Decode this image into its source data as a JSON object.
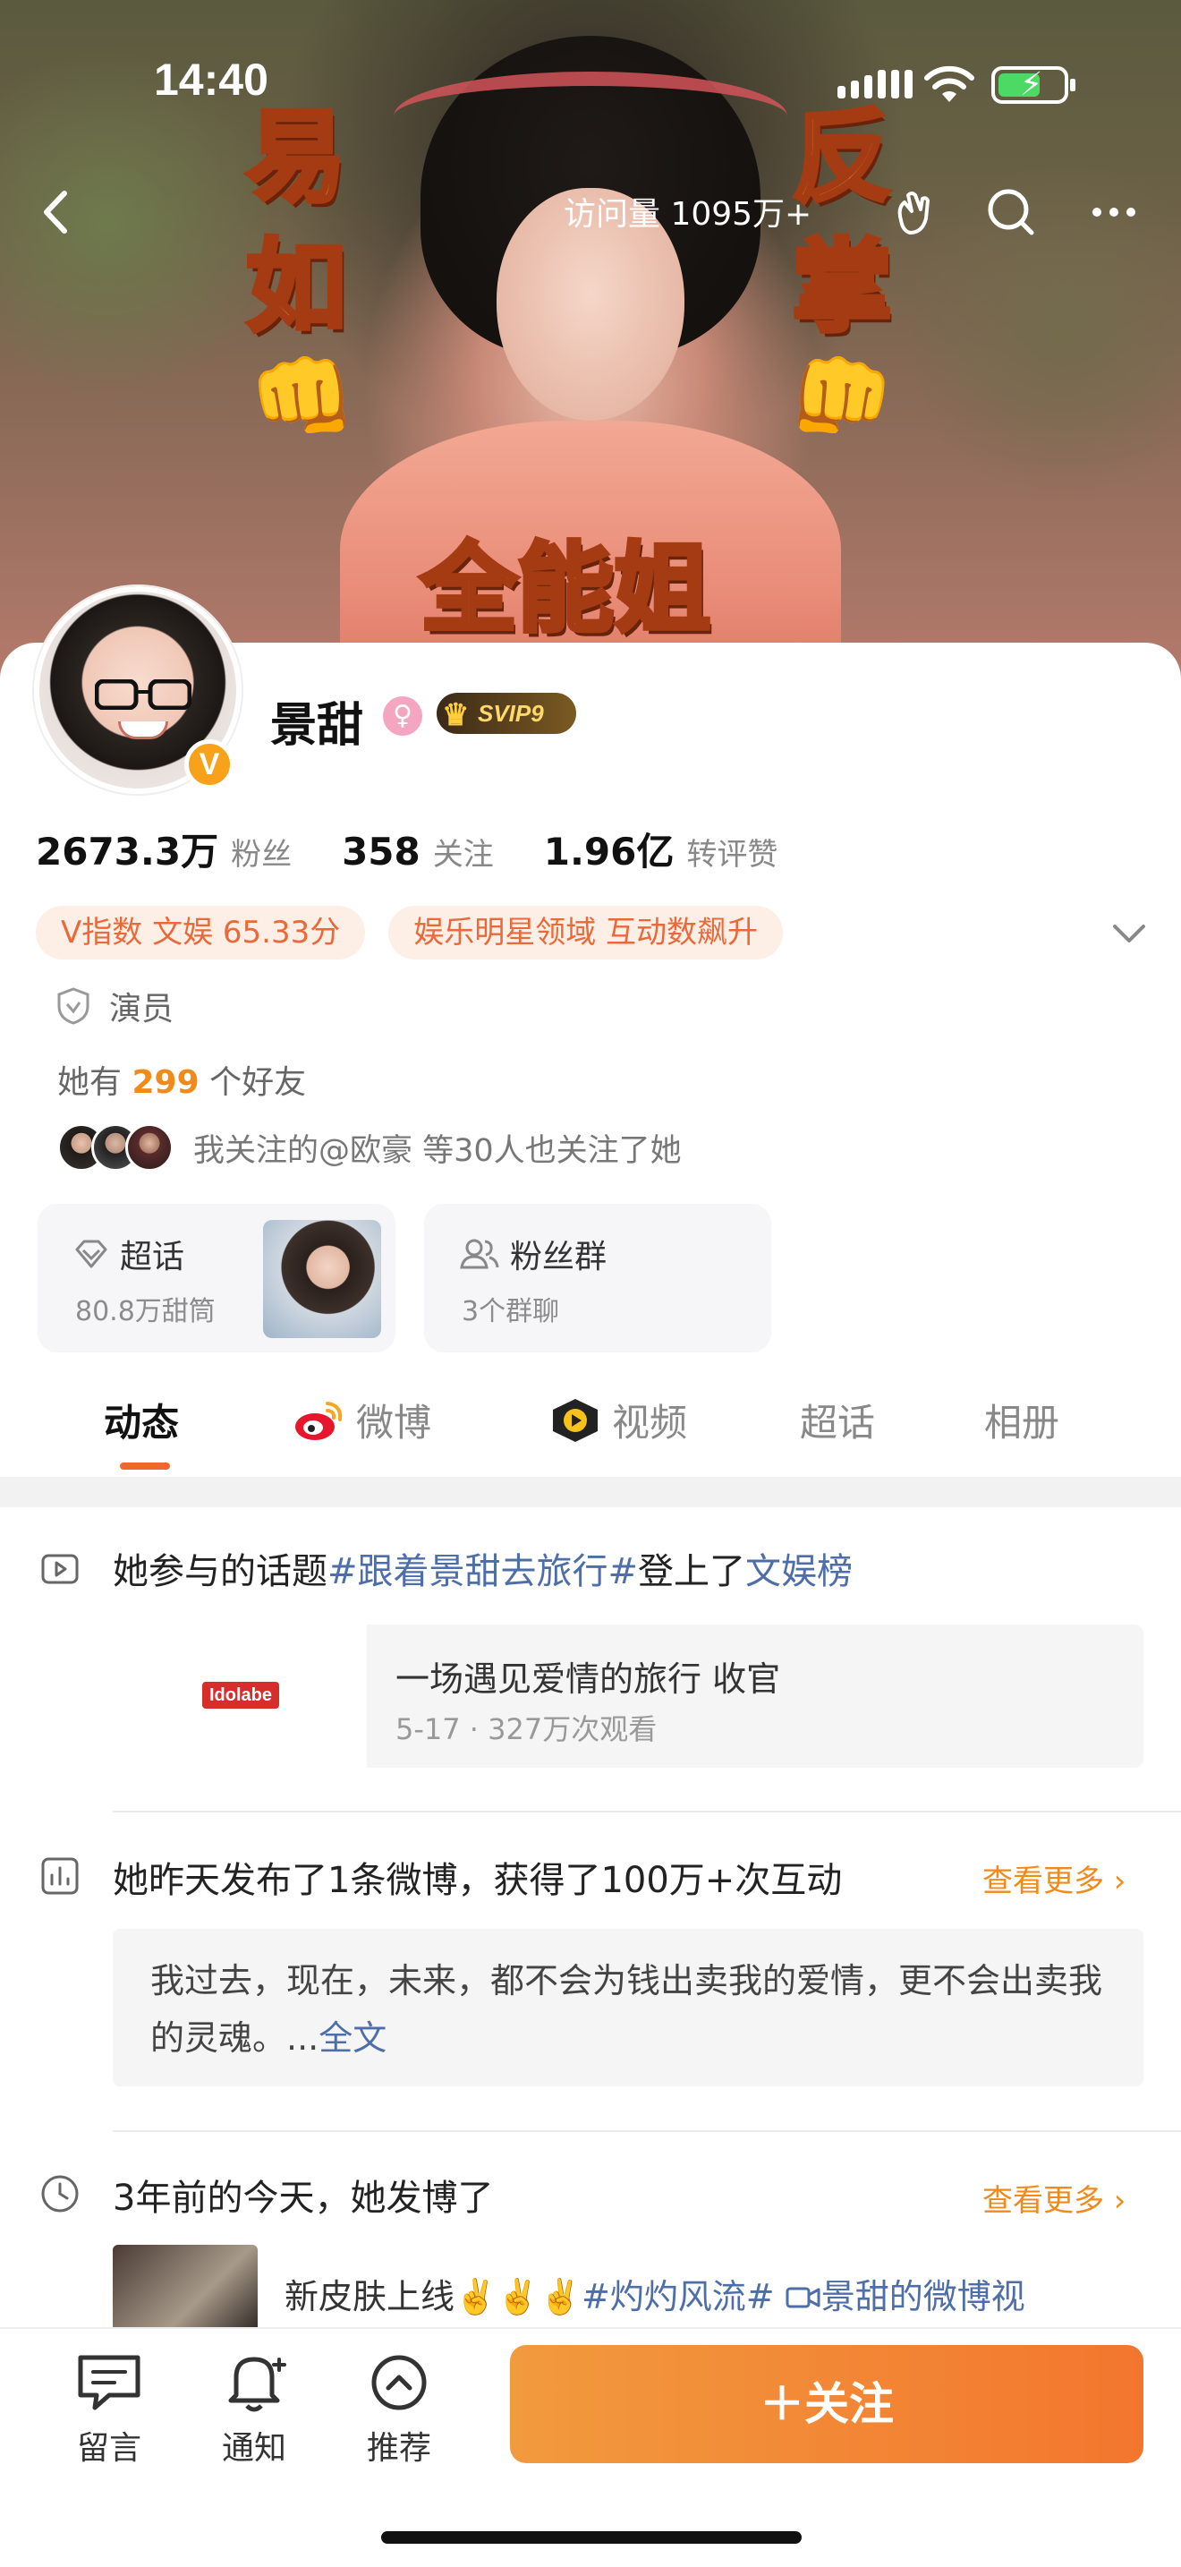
{
  "status_bar": {
    "time": "14:40"
  },
  "banner": {
    "visits": "访问量 1095万+",
    "captions": {
      "top_left_1": "易",
      "top_left_2": "如",
      "top_right_1": "反",
      "top_right_2": "掌",
      "bottom": "全能姐"
    },
    "fist_emoji": "👊"
  },
  "profile": {
    "name": "景甜",
    "gender_symbol": "♀",
    "vip_label": "SVIP9",
    "verified_mark": "V",
    "stats": [
      {
        "value": "2673.3万",
        "label": "粉丝"
      },
      {
        "value": "358",
        "label": "关注"
      },
      {
        "value": "1.96亿",
        "label": "转评赞"
      }
    ],
    "chips": [
      "V指数 文娱 65.33分",
      "娱乐明星领域 互动数飙升"
    ],
    "role": "演员",
    "friends": {
      "prefix": "她有",
      "count": "299",
      "suffix": "个好友"
    },
    "mutual_follow": "我关注的@欧豪 等30人也关注了她",
    "tiles": [
      {
        "title": "超话",
        "sub": "80.8万甜筒"
      },
      {
        "title": "粉丝群",
        "sub": "3个群聊"
      }
    ]
  },
  "tabs": [
    "动态",
    "微博",
    "视频",
    "超话",
    "相册"
  ],
  "feed": {
    "topic": {
      "prefix": "她参与的话题",
      "tag": "#跟着景甜去旅行#",
      "mid": "登上了",
      "board": "文娱榜"
    },
    "video": {
      "logo": "Idolabe",
      "title": "一场遇见爱情的旅行 收官",
      "meta": "5-17 · 327万次观看"
    },
    "yesterday": {
      "title": "她昨天发布了1条微博，获得了100万+次互动",
      "more": "查看更多 ›",
      "quote": "我过去，现在，未来，都不会为钱出卖我的爱情，更不会出卖我的灵魂。...",
      "full": "全文"
    },
    "memory": {
      "title": "3年前的今天，她发博了",
      "more": "查看更多 ›",
      "text_prefix": "新皮肤上线✌️✌️✌️",
      "tag": "#灼灼风流#",
      "video_link": "景甜的微博视"
    }
  },
  "bottom_bar": {
    "items": [
      "留言",
      "通知",
      "推荐"
    ],
    "follow": "＋关注"
  },
  "colors": {
    "accent": "#F3762E",
    "link": "#4E6EA8",
    "highlight": "#F08A1A",
    "chip_bg": "#FDEEE6"
  }
}
